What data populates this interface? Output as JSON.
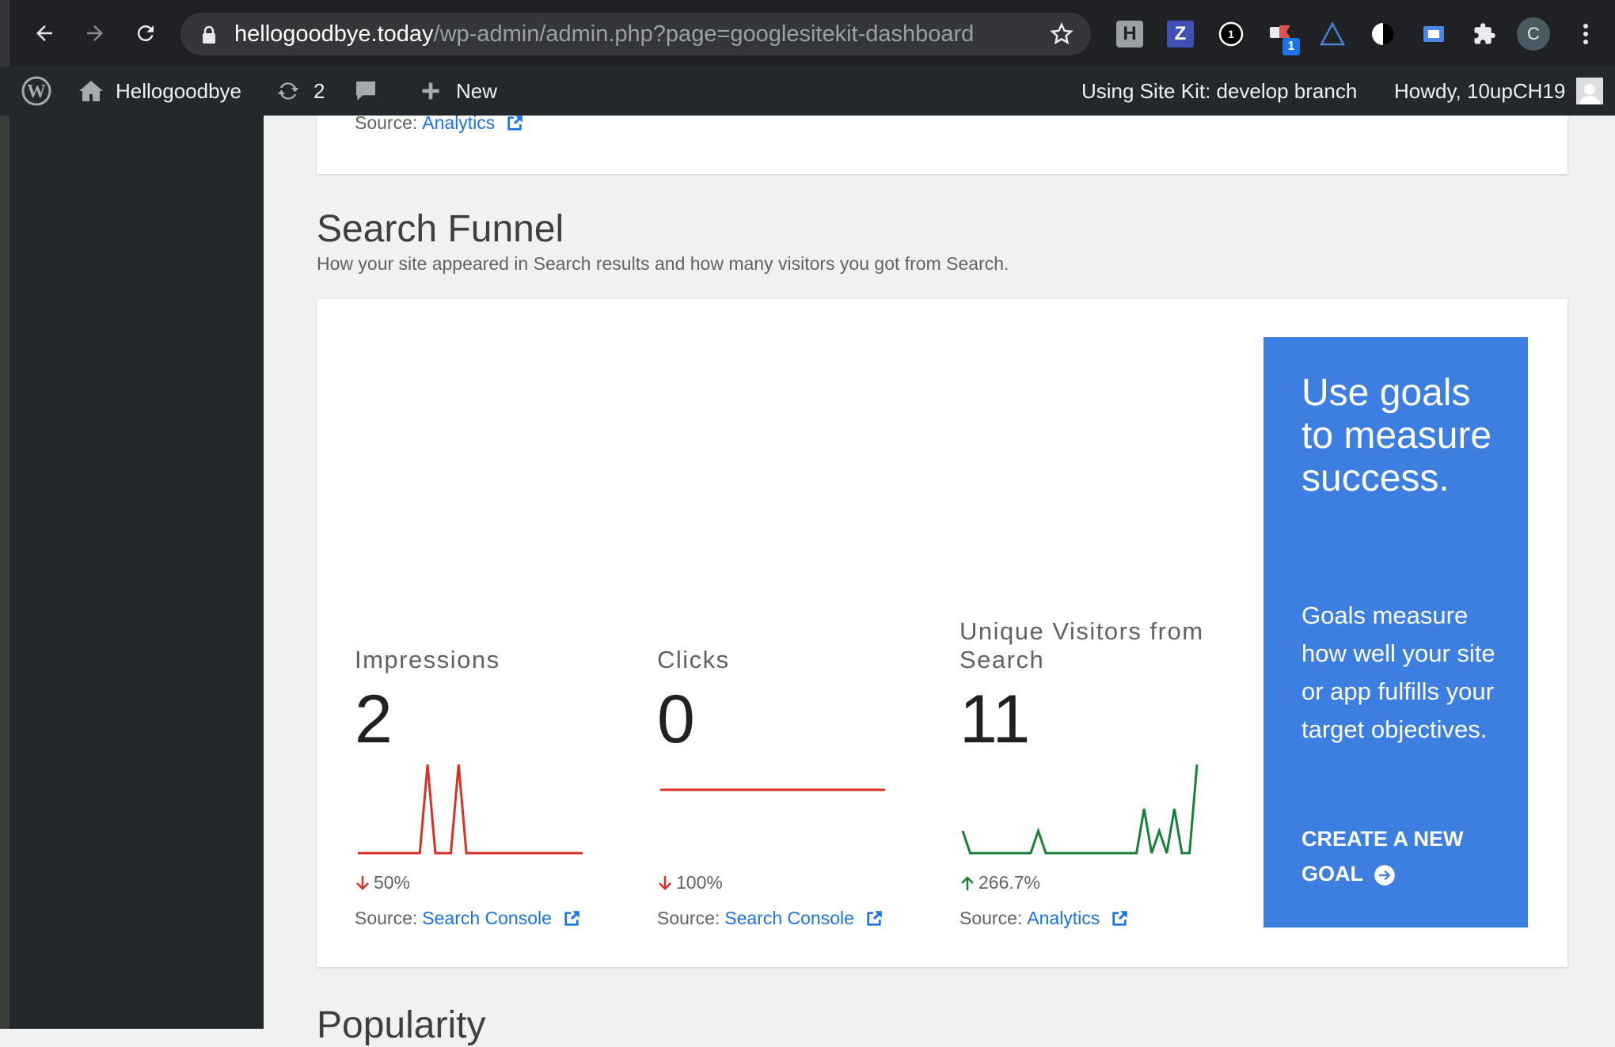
{
  "browser": {
    "url_host": "hellogoodbye.today",
    "url_path": "/wp-admin/admin.php?page=googlesitekit-dashboard",
    "extensions": [
      {
        "icon": "h-extension-icon",
        "label": "H"
      },
      {
        "icon": "z-extension-icon",
        "label": "Z"
      },
      {
        "icon": "onepassword-icon",
        "label": "1"
      },
      {
        "icon": "tab-extension-icon",
        "badge": "1"
      },
      {
        "icon": "triangle-extension-icon"
      },
      {
        "icon": "contrast-icon"
      },
      {
        "icon": "screen-extension-icon"
      },
      {
        "icon": "puzzle-icon"
      },
      {
        "icon": "profile-avatar",
        "label": "C"
      },
      {
        "icon": "kebab-menu-icon"
      }
    ]
  },
  "adminbar": {
    "site_name": "Hellogoodbye",
    "updates_count": "2",
    "new_label": "New",
    "sitekit_label": "Using Site Kit: develop branch",
    "howdy_label": "Howdy, 10upCH19"
  },
  "top_card": {
    "source_prefix": "Source:",
    "source_link": "Analytics"
  },
  "section": {
    "title": "Search Funnel",
    "subtitle": "How your site appeared in Search results and how many visitors you got from Search."
  },
  "metrics": [
    {
      "label": "Impressions",
      "value": "2",
      "change": "50%",
      "direction": "down",
      "line_color": "#d93025",
      "sparkline": [
        0,
        0,
        0,
        0,
        0,
        0,
        0,
        0,
        0,
        1,
        0,
        0,
        0,
        1,
        0,
        0,
        0,
        0,
        0,
        0,
        0,
        0,
        0,
        0,
        0,
        0,
        0,
        0,
        0,
        0
      ],
      "source_prefix": "Source:",
      "source_link": "Search Console"
    },
    {
      "label": "Clicks",
      "value": "0",
      "change": "100%",
      "direction": "down",
      "line_color": "#d93025",
      "sparkline": [
        0,
        0,
        0,
        0,
        0,
        0,
        0,
        0,
        0,
        0,
        0,
        0,
        0,
        0,
        0,
        0,
        0,
        0,
        0,
        0,
        0,
        0,
        0,
        0,
        0,
        0,
        0,
        0,
        0,
        0
      ],
      "source_prefix": "Source:",
      "source_link": "Search Console"
    },
    {
      "label": "Unique Visitors from Search",
      "value": "11",
      "change": "266.7%",
      "direction": "up",
      "line_color": "#188038",
      "sparkline": [
        1,
        0,
        0,
        0,
        0,
        0,
        0,
        0,
        0,
        0,
        1,
        0,
        0,
        0,
        0,
        0,
        0,
        0,
        0,
        0,
        0,
        0,
        0,
        0,
        2,
        0,
        1,
        0,
        2,
        0,
        0,
        4
      ],
      "source_prefix": "Source:",
      "source_link": "Analytics"
    }
  ],
  "cta": {
    "title": "Use goals to measure success.",
    "body": "Goals measure how well your site or app fulfills your target objectives.",
    "link_label": "CREATE A NEW GOAL"
  },
  "next_section": {
    "title": "Popularity"
  },
  "colors": {
    "link": "#1a73e8",
    "cta_bg": "#3c7fe0",
    "down": "#d93025",
    "up": "#188038"
  }
}
